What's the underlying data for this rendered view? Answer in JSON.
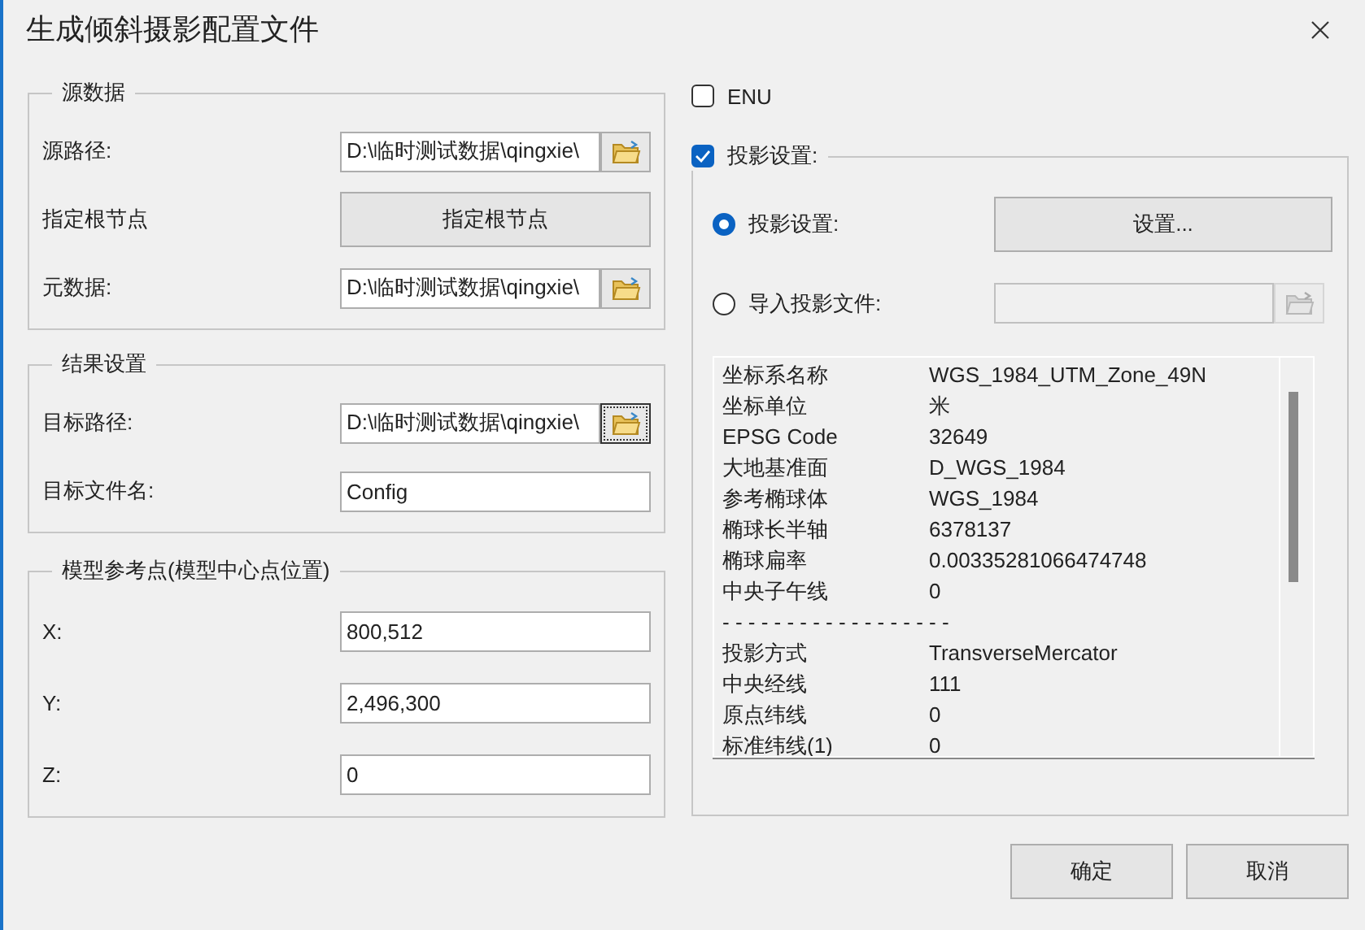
{
  "window": {
    "title": "生成倾斜摄影配置文件"
  },
  "source_group": {
    "title": "源数据",
    "rows": [
      {
        "kind": "path",
        "label": "源路径:",
        "value": "D:\\临时测试数据\\qingxie\\",
        "focused": false
      },
      {
        "kind": "button",
        "label": "指定根节点",
        "button": "指定根节点"
      },
      {
        "kind": "path",
        "label": "元数据:",
        "value": "D:\\临时测试数据\\qingxie\\",
        "focused": false
      }
    ]
  },
  "result_group": {
    "title": "结果设置",
    "rows": [
      {
        "kind": "path",
        "label": "目标路径:",
        "value": "D:\\临时测试数据\\qingxie\\",
        "focused": true
      },
      {
        "kind": "field",
        "label": "目标文件名:",
        "value": "Config"
      }
    ]
  },
  "model_group": {
    "title": "模型参考点(模型中心点位置)",
    "rows": [
      {
        "kind": "field",
        "label": "X:",
        "value": "800,512"
      },
      {
        "kind": "field",
        "label": "Y:",
        "value": "2,496,300"
      },
      {
        "kind": "field",
        "label": "Z:",
        "value": "0"
      }
    ]
  },
  "enu": {
    "label": "ENU",
    "checked": false
  },
  "projection": {
    "label": "投影设置:",
    "checked": true,
    "options": [
      {
        "kind": "button",
        "label": "投影设置:",
        "selected": true,
        "button": "设置..."
      },
      {
        "kind": "file",
        "label": "导入投影文件:",
        "selected": false,
        "disabled": true
      }
    ],
    "info": [
      {
        "kind": "pair",
        "name": "坐标系名称",
        "value": "WGS_1984_UTM_Zone_49N"
      },
      {
        "kind": "pair",
        "name": "坐标单位",
        "value": "米"
      },
      {
        "kind": "pair",
        "name": "EPSG Code",
        "value": "32649"
      },
      {
        "kind": "pair",
        "name": "大地基准面",
        "value": "D_WGS_1984"
      },
      {
        "kind": "pair",
        "name": "参考椭球体",
        "value": "WGS_1984"
      },
      {
        "kind": "pair",
        "name": "椭球长半轴",
        "value": "6378137"
      },
      {
        "kind": "pair",
        "name": "椭球扁率",
        "value": "0.00335281066474748"
      },
      {
        "kind": "pair",
        "name": "中央子午线",
        "value": "0"
      },
      {
        "kind": "separator",
        "name": "- - - - - - - - - - - - - - - - - -"
      },
      {
        "kind": "pair",
        "name": "投影方式",
        "value": "TransverseMercator"
      },
      {
        "kind": "pair",
        "name": "中央经线",
        "value": "111"
      },
      {
        "kind": "pair",
        "name": "原点纬线",
        "value": "0"
      },
      {
        "kind": "pair",
        "name": "标准纬线(1)",
        "value": "0"
      }
    ]
  },
  "buttons": [
    {
      "label": "确定"
    },
    {
      "label": "取消"
    }
  ]
}
